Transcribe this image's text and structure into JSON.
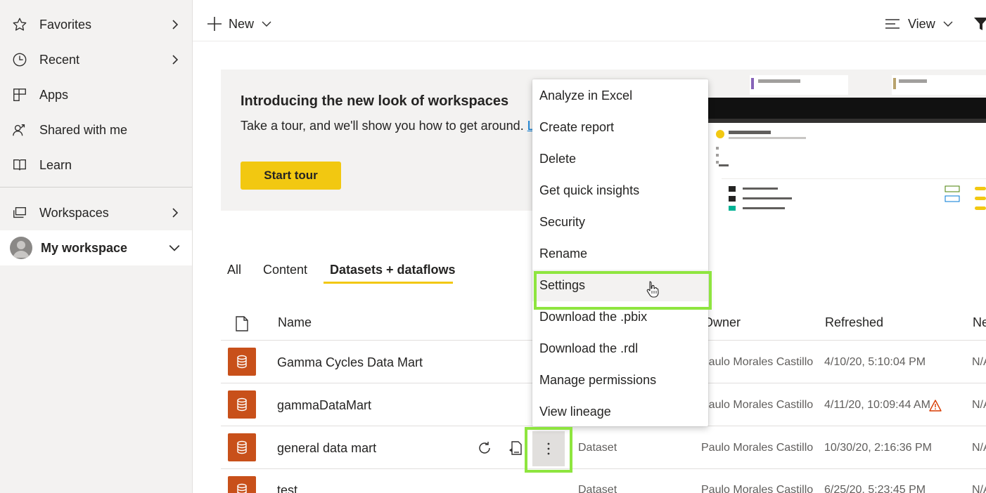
{
  "sidebar": {
    "items": [
      {
        "label": "Favorites",
        "icon": "star-icon"
      },
      {
        "label": "Recent",
        "icon": "clock-icon"
      },
      {
        "label": "Apps",
        "icon": "apps-icon"
      },
      {
        "label": "Shared with me",
        "icon": "shared-icon"
      },
      {
        "label": "Learn",
        "icon": "book-icon"
      },
      {
        "label": "Workspaces",
        "icon": "workspaces-icon"
      },
      {
        "label": "My workspace",
        "icon": "avatar"
      }
    ]
  },
  "toolbar": {
    "new_label": "New",
    "view_label": "View"
  },
  "banner": {
    "title": "Introducing the new look of workspaces",
    "text": "Take a tour, and we'll show you how to get around.",
    "link_text": "Le",
    "button_label": "Start tour"
  },
  "tabs": [
    {
      "label": "All"
    },
    {
      "label": "Content"
    },
    {
      "label": "Datasets + dataflows",
      "selected": true
    }
  ],
  "table": {
    "headers": {
      "name": "Name",
      "owner": "Owner",
      "refreshed": "Refreshed",
      "next": "Ne"
    },
    "rows": [
      {
        "name": "Gamma Cycles Data Mart",
        "type": "",
        "owner": "Paulo Morales Castillo",
        "refreshed": "4/10/20, 5:10:04 PM",
        "next": "N/A"
      },
      {
        "name": "gammaDataMart",
        "type": "",
        "owner": "Paulo Morales Castillo",
        "refreshed": "4/11/20, 10:09:44 AM",
        "next": "N/A",
        "warning": true
      },
      {
        "name": "general data mart",
        "type": "Dataset",
        "owner": "Paulo Morales Castillo",
        "refreshed": "10/30/20, 2:16:36 PM",
        "next": "N/A"
      },
      {
        "name": "test",
        "type": "Dataset",
        "owner": "Paulo Morales Castillo",
        "refreshed": "6/25/20, 5:23:45 PM",
        "next": "N/A"
      }
    ]
  },
  "context_menu": {
    "items": [
      "Analyze in Excel",
      "Create report",
      "Delete",
      "Get quick insights",
      "Security",
      "Rename",
      "Settings",
      "Download the .pbix",
      "Download the .rdl",
      "Manage permissions",
      "View lineage"
    ],
    "hovered": "Settings"
  },
  "colors": {
    "accent_yellow": "#f2c811",
    "dataset_orange": "#c8501a",
    "highlight_green": "#8ee53f",
    "link_blue": "#0078d4"
  }
}
